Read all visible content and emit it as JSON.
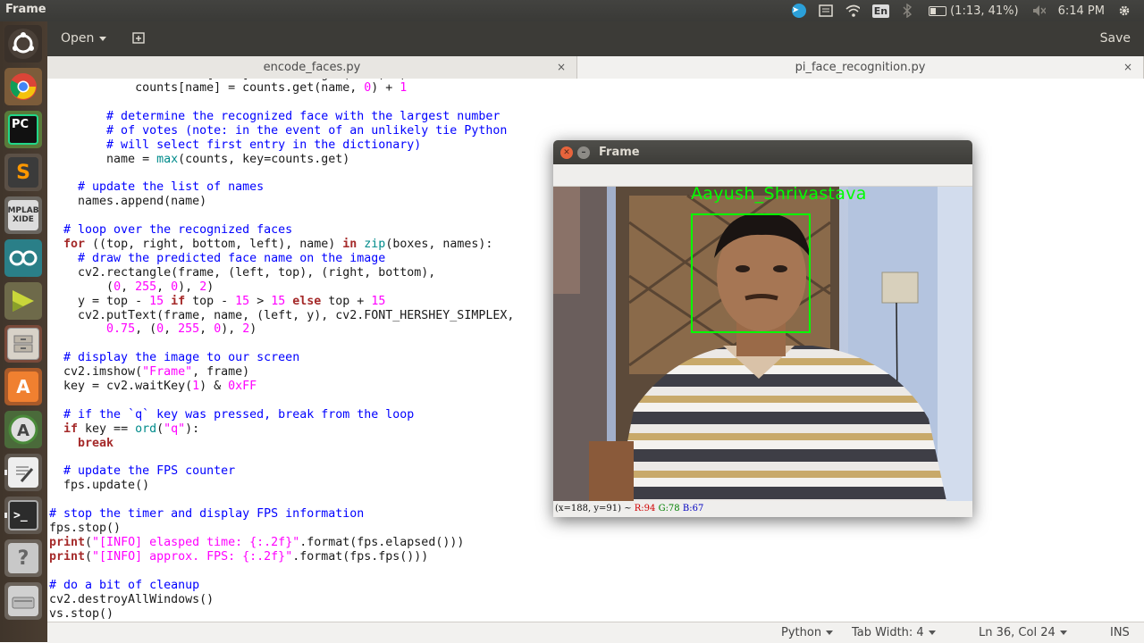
{
  "top_panel": {
    "title": "Frame",
    "battery": "(1:13, 41%)",
    "keyboard_layout": "En",
    "clock": "6:14 PM"
  },
  "launcher": {
    "apps": [
      "ubuntu-dash",
      "chrome",
      "pycharm",
      "sublime-text",
      "mplab-xide",
      "arduino",
      "xilinx",
      "file-manager",
      "software-center",
      "software-updater",
      "text-editor",
      "terminal",
      "help",
      "drive"
    ]
  },
  "toolbar": {
    "open_label": "Open",
    "save_label": "Save"
  },
  "tabs": [
    {
      "label": "encode_faces.py",
      "close": "×"
    },
    {
      "label": "pi_face_recognition.py",
      "close": "×"
    }
  ],
  "code_lines": [
    "            counts[name] = counts.get(name, 0) + 1",
    "",
    "        # determine the recognized face with the largest number",
    "        # of votes (note: in the event of an unlikely tie Python",
    "        # will select first entry in the dictionary)",
    "        name = max(counts, key=counts.get)",
    "",
    "    # update the list of names",
    "    names.append(name)",
    "",
    "  # loop over the recognized faces",
    "  for ((top, right, bottom, left), name) in zip(boxes, names):",
    "    # draw the predicted face name on the image",
    "    cv2.rectangle(frame, (left, top), (right, bottom),",
    "        (0, 255, 0), 2)",
    "    y = top - 15 if top - 15 > 15 else top + 15",
    "    cv2.putText(frame, name, (left, y), cv2.FONT_HERSHEY_SIMPLEX,",
    "        0.75, (0, 255, 0), 2)",
    "",
    "  # display the image to our screen",
    "  cv2.imshow(\"Frame\", frame)",
    "  key = cv2.waitKey(1) & 0xFF",
    "",
    "  # if the `q` key was pressed, break from the loop",
    "  if key == ord(\"q\"):",
    "    break",
    "",
    "  # update the FPS counter",
    "  fps.update()",
    "",
    "# stop the timer and display FPS information",
    "fps.stop()",
    "print(\"[INFO] elasped time: {:.2f}\".format(fps.elapsed()))",
    "print(\"[INFO] approx. FPS: {:.2f}\".format(fps.fps()))",
    "",
    "# do a bit of cleanup",
    "cv2.destroyAllWindows()",
    "vs.stop()"
  ],
  "status_bar": {
    "language": "Python",
    "tab_width": "Tab Width: 4",
    "position": "Ln 36, Col 24",
    "mode": "INS"
  },
  "frame_window": {
    "title": "Frame",
    "face_label": "Aayush_Shrivastava",
    "label_color": "#00ff00",
    "status_coords": "(x=188, y=91) ~",
    "status_r": "R:94",
    "status_g": "G:78",
    "status_b": "B:67"
  }
}
